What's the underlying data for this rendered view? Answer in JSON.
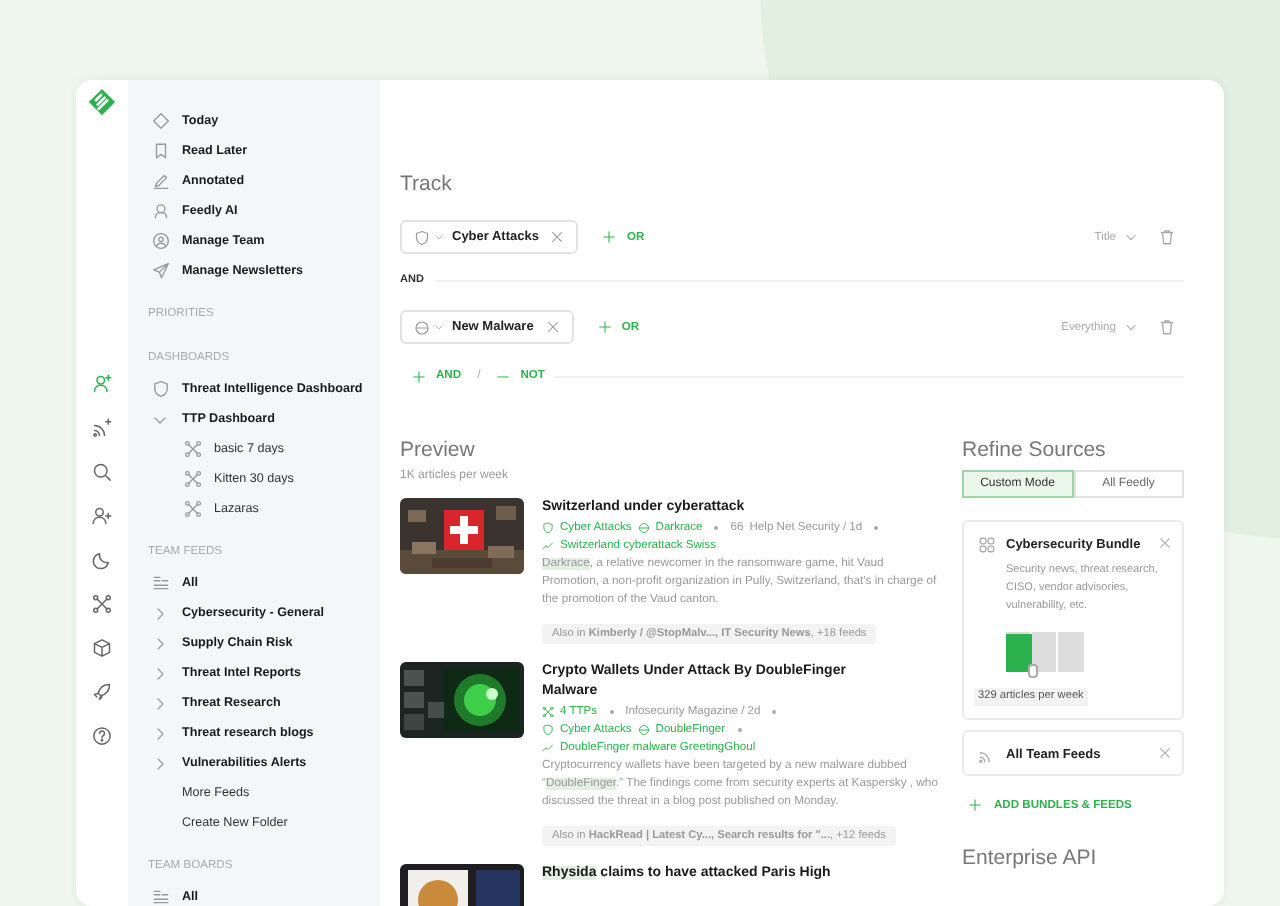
{
  "rail": [
    {
      "kind": "team-add",
      "selected": true
    },
    {
      "kind": "feed-add",
      "selected": false
    },
    {
      "kind": "search",
      "selected": false
    },
    {
      "kind": "person-add",
      "selected": false
    },
    {
      "kind": "moon",
      "selected": false
    },
    {
      "kind": "ttp",
      "selected": false
    },
    {
      "kind": "cube",
      "selected": false
    },
    {
      "kind": "rocket",
      "selected": false
    },
    {
      "kind": "help",
      "selected": false
    }
  ],
  "sidebar": {
    "nav": [
      {
        "label": "Today",
        "kind": "today"
      },
      {
        "label": "Read Later",
        "kind": "bookmark"
      },
      {
        "label": "Annotated",
        "kind": "pen"
      },
      {
        "label": "Feedly AI",
        "kind": "bot"
      },
      {
        "label": "Manage Team",
        "kind": "team"
      },
      {
        "label": "Manage Newsletters",
        "kind": "plane"
      }
    ],
    "sections": [
      {
        "title": "PRIORITIES"
      },
      {
        "title": "DASHBOARDS",
        "items": [
          {
            "label": "Threat Intelligence Dashboard",
            "kind": "shield"
          },
          {
            "label": "TTP Dashboard",
            "kind": "folder",
            "expanded": true,
            "children": [
              {
                "label": "basic 7 days",
                "kind": "ttp"
              },
              {
                "label": "Kitten 30 days",
                "kind": "ttp"
              },
              {
                "label": "Lazaras",
                "kind": "ttp"
              }
            ]
          }
        ]
      },
      {
        "title": "TEAM FEEDS",
        "items": [
          {
            "label": "All",
            "kind": "list"
          },
          {
            "label": "Cybersecurity - General",
            "kind": "folder",
            "expanded": false
          },
          {
            "label": "Supply Chain Risk",
            "kind": "folder",
            "expanded": false
          },
          {
            "label": "Threat Intel Reports",
            "kind": "folder",
            "expanded": false
          },
          {
            "label": "Threat Research",
            "kind": "folder",
            "expanded": false
          },
          {
            "label": "Threat research blogs",
            "kind": "folder",
            "expanded": false
          },
          {
            "label": "Vulnerabilities Alerts",
            "kind": "folder",
            "expanded": false
          },
          {
            "label": "More Feeds",
            "kind": "link"
          },
          {
            "label": "Create New Folder",
            "kind": "link"
          }
        ]
      },
      {
        "title": "TEAM BOARDS",
        "items": [
          {
            "label": "All",
            "kind": "list"
          }
        ]
      }
    ]
  },
  "track": {
    "title": "Track",
    "rules": [
      {
        "kind": "topic",
        "term": "Cyber Attacks",
        "or_label": "OR",
        "scope": "Title"
      },
      {
        "kind": "threat",
        "term": "New Malware",
        "or_label": "OR",
        "scope": "Everything"
      }
    ],
    "connector": "AND",
    "add_and": "AND",
    "separator": "/",
    "add_not": "NOT"
  },
  "preview": {
    "title": "Preview",
    "subtitle": "1K articles per week",
    "articles": [
      {
        "title": [
          {
            "text": "Switzerland under cyberattack",
            "highlight": false
          }
        ],
        "meta_lines": [
          [
            {
              "kind": "topic",
              "text": "Cyber Attacks"
            },
            {
              "kind": "threat",
              "text": "Darkrace"
            },
            {
              "kind": "dot"
            },
            {
              "kind": "count",
              "text": "66"
            },
            {
              "kind": "source",
              "text": "Help Net Security / 1d"
            },
            {
              "kind": "dot"
            }
          ],
          [
            {
              "kind": "trend",
              "text": "Switzerland cyberattack Swiss"
            }
          ]
        ],
        "summary": [
          {
            "text": "Darkrace",
            "highlight": true
          },
          {
            "text": ", a relative newcomer in the ransomware game, hit Vaud Promotion, a non-profit organization in Pully, Switzerland, that's in charge of the promotion of the Vaud canton.",
            "highlight": false
          }
        ],
        "also_in": "Also in **Kimberly / @StopMalv..., IT Security News**, +18 feeds"
      },
      {
        "title": [
          {
            "text": "Crypto Wallets Under Attack By DoubleFinger Malware",
            "highlight": false
          }
        ],
        "meta_lines": [
          [
            {
              "kind": "ttp",
              "text": "4 TTPs"
            },
            {
              "kind": "dot"
            },
            {
              "kind": "source",
              "text": "Infosecurity Magazine / 2d"
            },
            {
              "kind": "dot"
            }
          ],
          [
            {
              "kind": "topic",
              "text": "Cyber Attacks"
            },
            {
              "kind": "threat",
              "text": "DoubleFinger"
            },
            {
              "kind": "dot"
            }
          ],
          [
            {
              "kind": "trend",
              "text": "DoubleFinger malware GreetingGhoul"
            }
          ]
        ],
        "summary": [
          {
            "text": "Cryptocurrency wallets have been targeted by a new malware dubbed “",
            "highlight": false
          },
          {
            "text": "DoubleFinger",
            "highlight": true
          },
          {
            "text": ".” The findings come from security experts at Kaspersky , who discussed the threat in a blog post published on Monday.",
            "highlight": false
          }
        ],
        "also_in": "Also in **HackRead | Latest Cy..., Search results for \"...**, +12 feeds"
      },
      {
        "title": [
          {
            "text": "Rhysida",
            "highlight": true
          },
          {
            "text": " claims to have attacked Paris High",
            "highlight": false
          }
        ]
      }
    ]
  },
  "refine": {
    "title": "Refine Sources",
    "modes": [
      {
        "label": "Custom Mode",
        "selected": true
      },
      {
        "label": "All Feedly",
        "selected": false
      }
    ],
    "sources": [
      {
        "kind": "bundle",
        "title": "Cybersecurity Bundle",
        "description": "Security news, threat research, CISO, vendor advisories, vulnerability, etc.",
        "level": 0.33,
        "reading": "329 articles per week"
      },
      {
        "kind": "feeds",
        "title": "All Team Feeds"
      }
    ],
    "add_label": "ADD BUNDLES & FEEDS"
  },
  "enterprise": {
    "title": "Enterprise API"
  }
}
